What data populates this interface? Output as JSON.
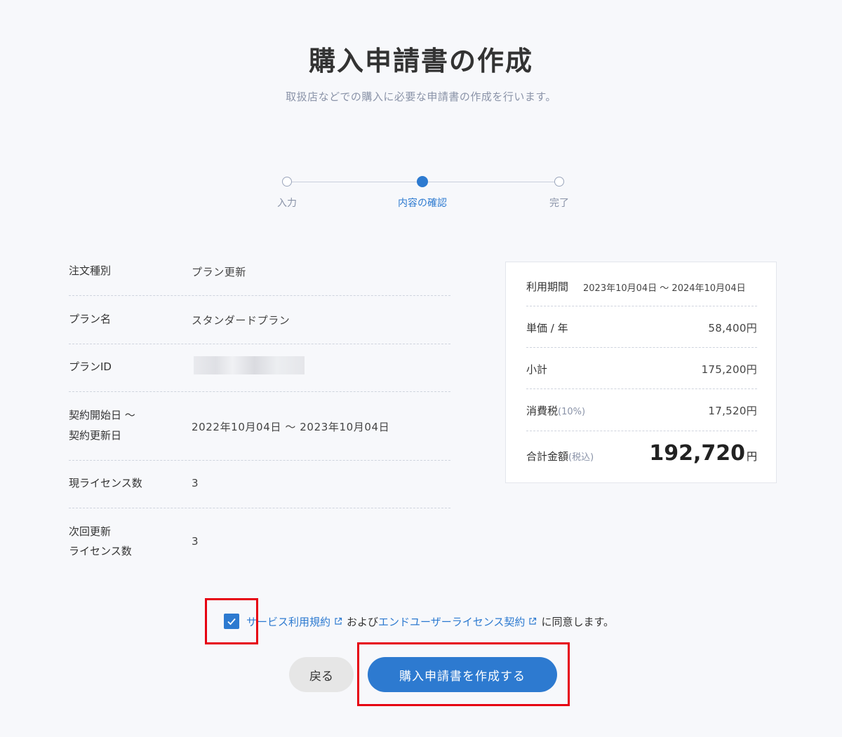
{
  "header": {
    "title": "購入申請書の作成",
    "subtitle": "取扱店などでの購入に必要な申請書の作成を行います。"
  },
  "stepper": {
    "steps": [
      {
        "label": "入力",
        "state": "done"
      },
      {
        "label": "内容の確認",
        "state": "active"
      },
      {
        "label": "完了",
        "state": "todo"
      }
    ]
  },
  "details": {
    "rows": [
      {
        "key": "注文種別",
        "value": "プラン更新"
      },
      {
        "key": "プラン名",
        "value": "スタンダードプラン"
      },
      {
        "key": "プランID",
        "value": ""
      },
      {
        "key_line1": "契約開始日 ～",
        "key_line2": "契約更新日",
        "value": "2022年10月04日 ～ 2023年10月04日"
      },
      {
        "key": "現ライセンス数",
        "value": "3"
      },
      {
        "key_line1": "次回更新",
        "key_line2": "ライセンス数",
        "value": "3"
      }
    ]
  },
  "summary": {
    "period_label": "利用期間",
    "period_value": "2023年10月04日 ～ 2024年10月04日",
    "unit_price_label": "単価 / 年",
    "unit_price_value": "58,400円",
    "subtotal_label": "小計",
    "subtotal_value": "175,200円",
    "tax_label": "消費税",
    "tax_rate": "(10%)",
    "tax_value": "17,520円",
    "total_label": "合計金額",
    "total_note": "(税込)",
    "total_value": "192,720",
    "total_unit": "円"
  },
  "agreement": {
    "checked": true,
    "terms_link": "サービス利用規約",
    "and_text": "および",
    "eula_link": "エンドユーザーライセンス契約",
    "suffix": "に同意します。"
  },
  "buttons": {
    "back_label": "戻る",
    "create_label": "購入申請書を作成する"
  },
  "colors": {
    "accent": "#2d7ad0",
    "highlight": "#e60012",
    "background": "#f7f8fb"
  }
}
